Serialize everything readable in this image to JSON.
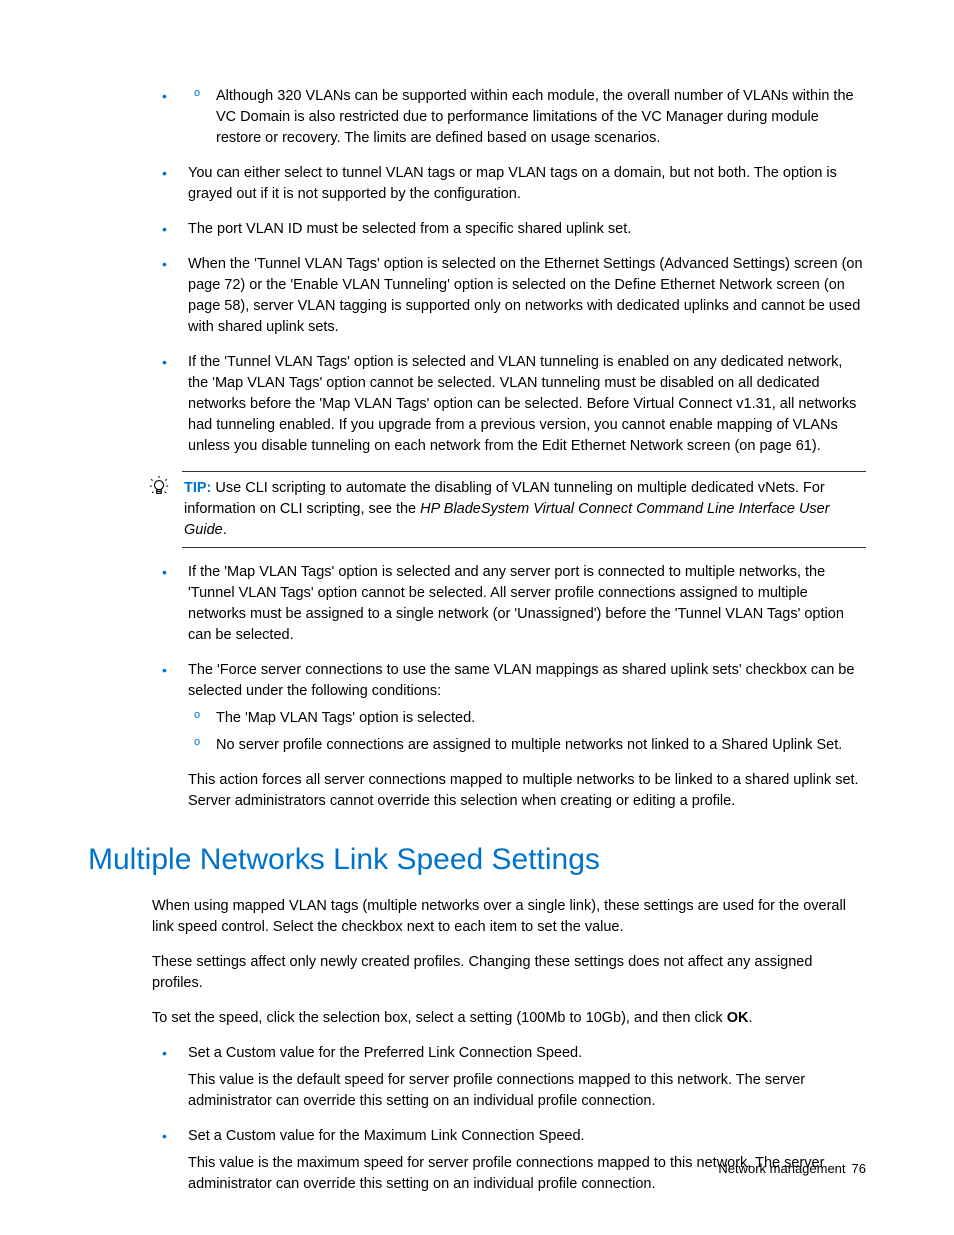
{
  "top_nested_item": "Although 320 VLANs can be supported within each module, the overall number of VLANs within the VC Domain is also restricted due to performance limitations of the VC Manager during module restore or recovery. The limits are defined based on usage scenarios.",
  "bullets": [
    "You can either select to tunnel VLAN tags or map VLAN tags on a domain, but not both. The option is grayed out if it is not supported by the configuration.",
    "The port VLAN ID must be selected from a specific shared uplink set.",
    "When the 'Tunnel VLAN Tags' option is selected on the Ethernet Settings (Advanced Settings) screen (on page 72) or the 'Enable VLAN Tunneling' option is selected on the Define Ethernet Network screen (on page 58), server VLAN tagging is supported only on networks with dedicated uplinks and cannot be used with shared uplink sets.",
    "If the 'Tunnel VLAN Tags' option is selected and VLAN tunneling is enabled on any dedicated network, the 'Map VLAN Tags' option cannot be selected. VLAN tunneling must be disabled on all dedicated networks before the 'Map VLAN Tags' option can be selected. Before Virtual Connect v1.31, all networks had tunneling enabled. If you upgrade from a previous version, you cannot enable mapping of VLANs unless you disable tunneling on each network from the Edit Ethernet Network screen (on page 61)."
  ],
  "tip": {
    "label": "TIP:",
    "text_before": "  Use CLI scripting to automate the disabling of VLAN tunneling on multiple dedicated vNets. For information on CLI scripting, see the ",
    "italic": "HP BladeSystem Virtual Connect Command Line Interface User Guide",
    "after": "."
  },
  "bullets2": [
    "If the 'Map VLAN Tags' option is selected and any server port is connected to multiple networks, the 'Tunnel VLAN Tags' option cannot be selected. All server profile connections assigned to multiple networks must be assigned to a single network (or 'Unassigned') before the 'Tunnel VLAN Tags' option can be selected.",
    "The 'Force server connections to use the same VLAN mappings as shared uplink sets' checkbox can be selected under the following conditions:"
  ],
  "inner2": [
    "The 'Map VLAN Tags' option is selected.",
    "No server profile connections are assigned to multiple networks not linked to a Shared Uplink Set."
  ],
  "after_inner": "This action forces all server connections mapped to multiple networks to be linked to a shared uplink set. Server administrators cannot override this selection when creating or editing a profile.",
  "section_title": "Multiple Networks Link Speed Settings",
  "section_paras": [
    "When using mapped VLAN tags (multiple networks over a single link), these settings are used for the overall link speed control. Select the checkbox next to each item to set the value.",
    "These settings affect only newly created profiles. Changing these settings does not affect any assigned profiles."
  ],
  "section_speed_before": "To set the speed, click the selection box, select a setting (100Mb to 10Gb), and then click ",
  "section_speed_bold": "OK",
  "section_speed_after": ".",
  "section_bullets": [
    {
      "head": "Set a Custom value for the Preferred Link Connection Speed.",
      "body": "This value is the default speed for server profile connections mapped to this network. The server administrator can override this setting on an individual profile connection."
    },
    {
      "head": "Set a Custom value for the Maximum Link Connection Speed.",
      "body": "This value is the maximum speed for server profile connections mapped to this network. The server administrator can override this setting on an individual profile connection."
    }
  ],
  "footer": {
    "section": "Network management",
    "page": "76"
  }
}
